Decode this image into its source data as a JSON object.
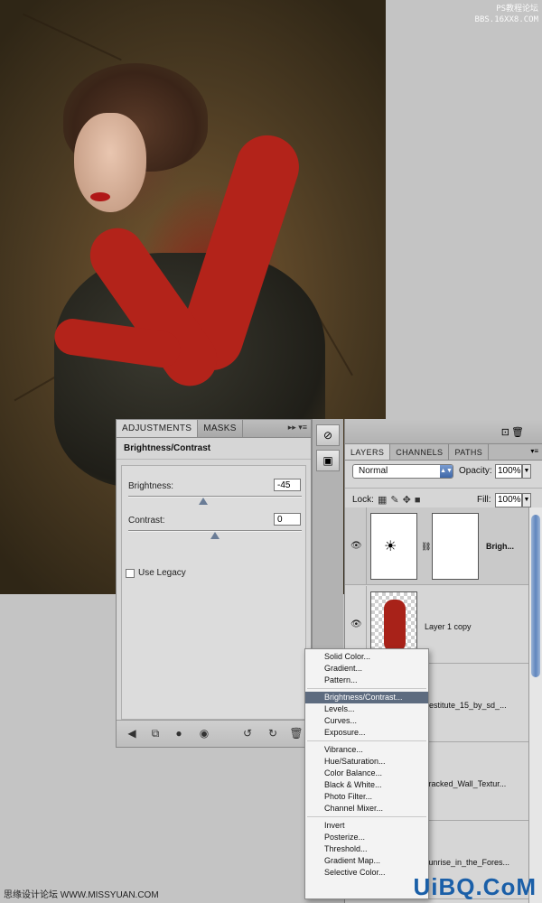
{
  "watermark": {
    "top_line1": "PS教程论坛",
    "top_line2": "BBS.16XX8.COM",
    "bottom_left": "思缘设计论坛 WWW.MISSYUAN.COM",
    "bottom_right": "UiBQ.CoM"
  },
  "adjustments": {
    "tabs": [
      {
        "label": "ADJUSTMENTS",
        "active": true
      },
      {
        "label": "MASKS",
        "active": false
      }
    ],
    "menu_glyph": "▸▸ ▾≡",
    "title": "Brightness/Contrast",
    "brightness": {
      "label": "Brightness:",
      "value": "-45",
      "slider_fraction": 0.43
    },
    "contrast": {
      "label": "Contrast:",
      "value": "0",
      "slider_fraction": 0.5
    },
    "use_legacy": {
      "label": "Use Legacy",
      "checked": false
    },
    "footer_icons": [
      "back-arrow-icon",
      "clip-to-layer-icon",
      "mask-icon",
      "eye-icon",
      "previous-state-icon",
      "reset-icon",
      "trash-icon"
    ]
  },
  "strip": {
    "buttons": [
      "brush-preset-icon",
      "mask-toggle-icon"
    ]
  },
  "layers": {
    "tabs": [
      {
        "label": "LAYERS",
        "active": true
      },
      {
        "label": "CHANNELS",
        "active": false
      },
      {
        "label": "PATHS",
        "active": false
      }
    ],
    "blend_mode": "Normal",
    "opacity_label": "Opacity:",
    "opacity_value": "100%",
    "lock_label": "Lock:",
    "fill_label": "Fill:",
    "fill_value": "100%",
    "rows": [
      {
        "name": "Brigh...",
        "type": "adjustment",
        "selected": true
      },
      {
        "name": "Layer 1 copy",
        "type": "image",
        "selected": false
      },
      {
        "name": "destitute_15_by_sd_...",
        "type": "image",
        "selected": false
      },
      {
        "name": "cracked_Wall_Textur...",
        "type": "image",
        "selected": false
      },
      {
        "name": "sunrise_in_the_Fores...",
        "type": "image",
        "selected": false
      }
    ]
  },
  "menu": {
    "groups": [
      [
        "Solid Color...",
        "Gradient...",
        "Pattern..."
      ],
      [
        "Brightness/Contrast...",
        "Levels...",
        "Curves...",
        "Exposure..."
      ],
      [
        "Vibrance...",
        "Hue/Saturation...",
        "Color Balance...",
        "Black & White...",
        "Photo Filter...",
        "Channel Mixer..."
      ],
      [
        "Invert",
        "Posterize...",
        "Threshold...",
        "Gradient Map...",
        "Selective Color..."
      ]
    ],
    "highlighted": "Brightness/Contrast..."
  }
}
